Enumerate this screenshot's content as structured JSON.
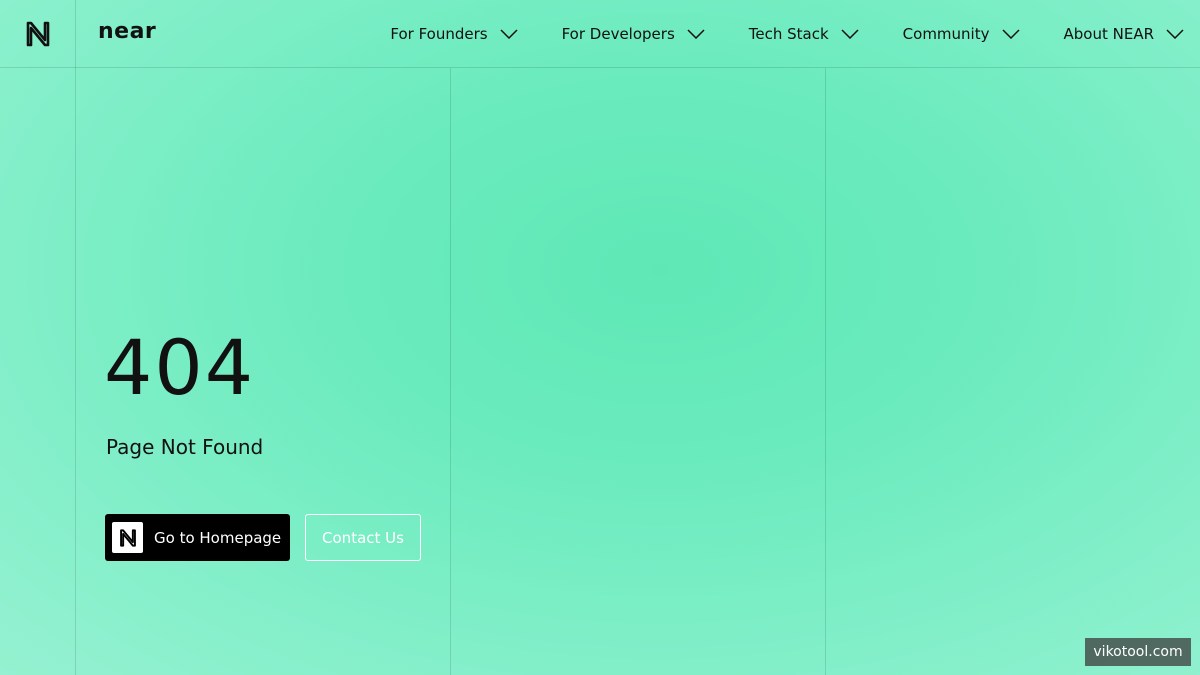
{
  "header": {
    "wordmark": "near",
    "nav": [
      {
        "label": "For Founders"
      },
      {
        "label": "For Developers"
      },
      {
        "label": "Tech Stack"
      },
      {
        "label": "Community"
      },
      {
        "label": "About NEAR"
      }
    ]
  },
  "main": {
    "code": "404",
    "message": "Page Not Found",
    "home_button": "Go to Homepage",
    "contact_button": "Contact Us"
  },
  "watermark": "vikotool.com",
  "colors": {
    "background": "#6bebbe",
    "primary_button": "#000000",
    "text": "#111111"
  },
  "icons": {
    "logo": "near-logo-icon",
    "chevron": "chevron-down-icon"
  }
}
